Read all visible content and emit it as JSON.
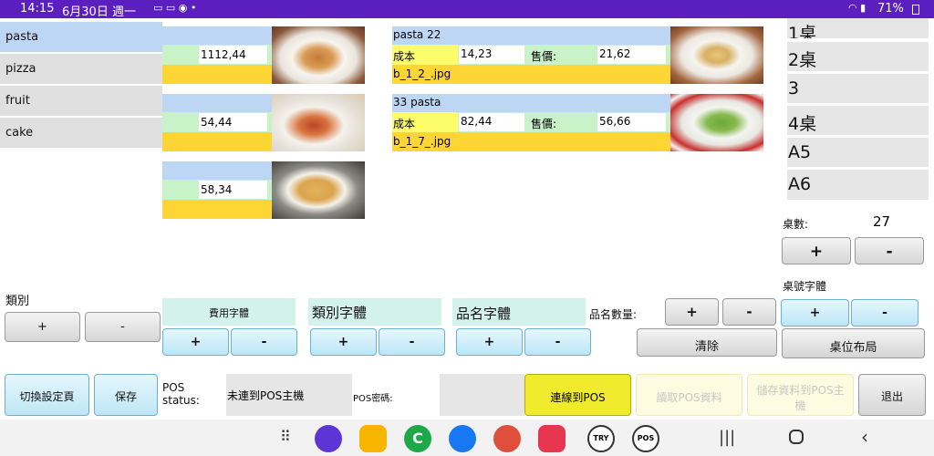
{
  "status_bar": {
    "time": "14:15",
    "date": "6月30日 週一",
    "battery": "71%"
  },
  "categories": [
    "pasta",
    "pizza",
    "fruit",
    "cake"
  ],
  "items_small": [
    {
      "price": "1112,44"
    },
    {
      "price": "54,44"
    },
    {
      "price": "58,34"
    }
  ],
  "items_large": [
    {
      "name": "pasta 22",
      "cost_label": "成本",
      "cost": "14,23",
      "sale_label": "售價:",
      "sale": "21,62",
      "file": "b_1_2_.jpg"
    },
    {
      "name": "33 pasta",
      "cost_label": "成本",
      "cost": "82,44",
      "sale_label": "售價:",
      "sale": "56,66",
      "file": "b_1_7_.jpg"
    }
  ],
  "tables": [
    "1桌",
    "2桌",
    "3",
    "4桌",
    "A5",
    "A6"
  ],
  "table_count": {
    "label": "桌數:",
    "value": "27"
  },
  "table_font_label": "桌號字體",
  "category_label": "類別",
  "font_labels": {
    "price": "費用字體",
    "category": "類別字體",
    "name": "品名字體"
  },
  "name_count_label": "品名數量:",
  "plus": "+",
  "minus": "-",
  "clear_label": "清除",
  "layout_label": "桌位布局",
  "bottom": {
    "switch": "切換設定頁",
    "save": "保存",
    "pos_status_label": "POS status:",
    "pos_status_value": "未連到POS主機",
    "pos_pw_label": "POS密碼:",
    "connect": "連線到POS",
    "read": "讀取POS資料",
    "store": "儲存資料到POS主機",
    "exit": "退出"
  }
}
